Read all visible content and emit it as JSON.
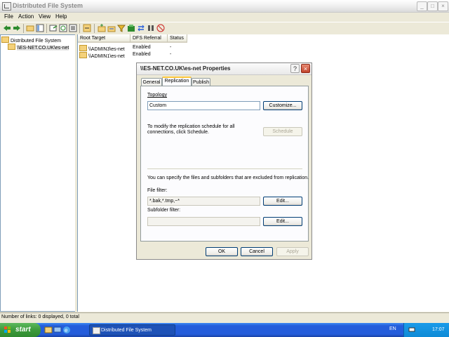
{
  "window": {
    "title": "Distributed File System",
    "buttons": {
      "minimize": "_",
      "maximize": "□",
      "close": "×"
    }
  },
  "menu": [
    {
      "label": "File"
    },
    {
      "label": "Action"
    },
    {
      "label": "View"
    },
    {
      "label": "Help"
    }
  ],
  "tree": {
    "root": "Distributed File System",
    "child": "\\\\ES-NET.CO.UK\\es-net"
  },
  "list": {
    "columns": [
      "Root Target",
      "DFS Referral",
      "Status"
    ],
    "rows": [
      {
        "target": "\\\\ADMIN3\\es-net",
        "referral": "Enabled",
        "status": "-"
      },
      {
        "target": "\\\\ADMIN1\\es-net",
        "referral": "Enabled",
        "status": "-"
      }
    ]
  },
  "statusbar": {
    "text": "Number of links: 0 displayed, 0 total"
  },
  "taskbar": {
    "start": "start",
    "task": "Distributed File System",
    "lang": "EN",
    "clock": "17:07"
  },
  "dialog": {
    "title": "\\\\ES-NET.CO.UK\\es-net Properties",
    "help": "?",
    "close": "×",
    "tabs": [
      {
        "label": "General"
      },
      {
        "label": "Replication"
      },
      {
        "label": "Publish"
      }
    ],
    "topology_label": "Topology",
    "topology_value": "Custom",
    "customize_label": "Customize...",
    "schedule_text": "To modify the replication schedule for all connections, click Schedule.",
    "schedule_label": "Schedule",
    "exclusion_text": "You can specify the files and subfolders that are excluded from replication.",
    "file_filter_label": "File filter:",
    "file_filter_value": "*.bak,*.tmp,~*",
    "edit_label": "Edit...",
    "subfolder_filter_label": "Subfolder filter:",
    "subfolder_filter_value": "",
    "ok": "OK",
    "cancel": "Cancel",
    "apply": "Apply"
  },
  "colors": {
    "taskbar": "#245DDB",
    "start": "#3C9B3C",
    "tab_accent": "#FFC83C"
  }
}
